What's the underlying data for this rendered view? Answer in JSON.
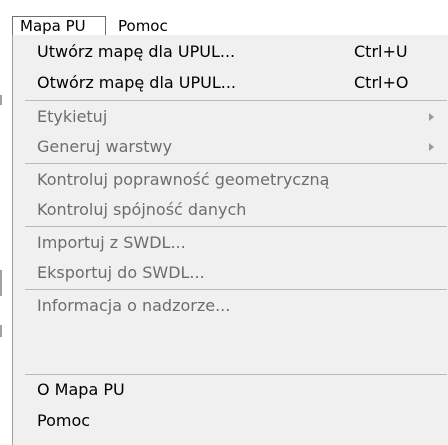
{
  "menubar": {
    "items": [
      {
        "label": "Mapa PU"
      },
      {
        "label": "Pomoc"
      }
    ]
  },
  "dropdown": {
    "items": [
      {
        "label": "Utwórz mapę dla UPUL...",
        "shortcut": "Ctrl+U",
        "enabled": true
      },
      {
        "label": "Otwórz mapę dla UPUL...",
        "shortcut": "Ctrl+O",
        "enabled": true
      },
      {
        "label": "Etykietuj",
        "submenu": true,
        "enabled": false
      },
      {
        "label": "Generuj warstwy",
        "submenu": true,
        "enabled": false
      },
      {
        "label": "Kontroluj poprawność geometryczną",
        "enabled": false
      },
      {
        "label": "Kontroluj spójność danych",
        "enabled": false
      },
      {
        "label": "Importuj z SWDL...",
        "enabled": false
      },
      {
        "label": "Eksportuj do SWDL...",
        "enabled": false
      },
      {
        "label": "Informacja o nadzorze...",
        "enabled": false
      },
      {
        "label": "O Mapa PU",
        "enabled": true
      },
      {
        "label": "Pomoc",
        "enabled": true
      }
    ]
  },
  "colors": {
    "menu_background": "#f0f0f0",
    "enabled_text": "#000000",
    "disabled_text": "#6d6d6d",
    "separator": "#b9b9b9"
  }
}
